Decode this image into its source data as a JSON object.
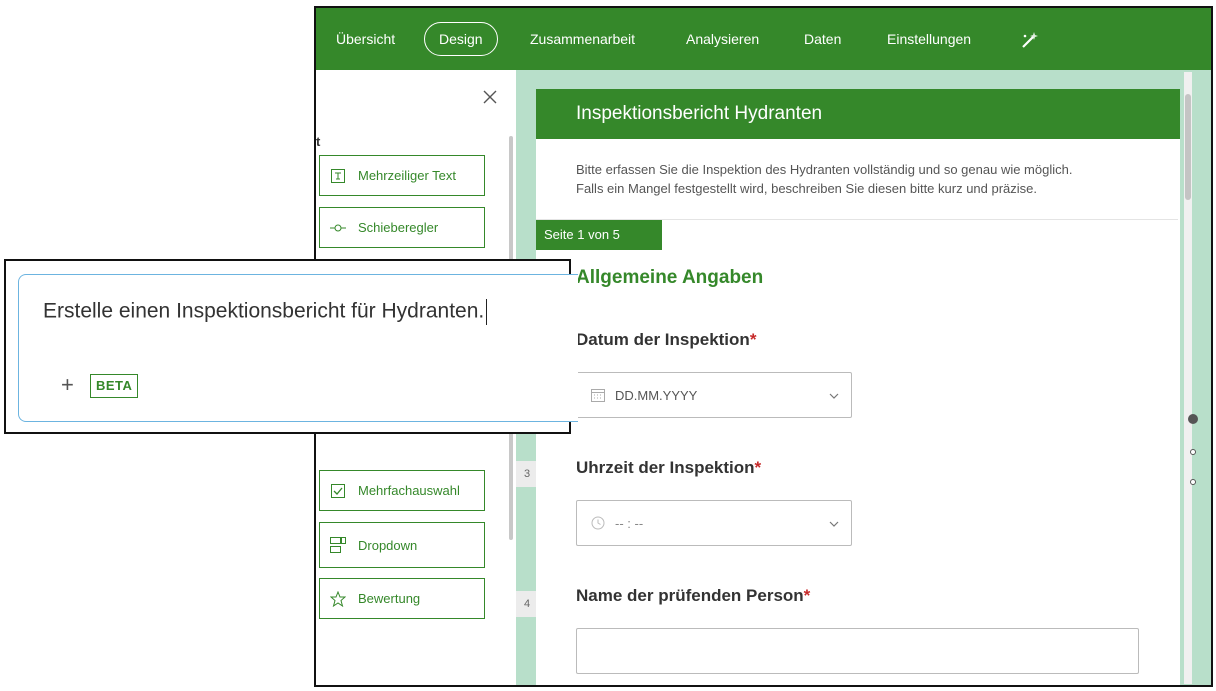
{
  "nav": {
    "overview": "Übersicht",
    "design": "Design",
    "collaborate": "Zusammenarbeit",
    "analyze": "Analysieren",
    "data": "Daten",
    "settings": "Einstellungen",
    "tools_icon": "wand-icon"
  },
  "left_panel": {
    "header_fragment": "t",
    "elements": [
      {
        "label": "Mehrzeiliger Text",
        "icon": "multiline-text-icon"
      },
      {
        "label": "Schieberegler",
        "icon": "slider-icon"
      },
      {
        "label": "Mehrfachauswahl",
        "icon": "checkbox-icon"
      },
      {
        "label": "Dropdown",
        "icon": "dropdown-icon"
      },
      {
        "label": "Bewertung",
        "icon": "star-icon"
      }
    ]
  },
  "row_numbers": [
    "3",
    "4"
  ],
  "form": {
    "title": "Inspektionsbericht Hydranten",
    "description_line1": "Bitte erfassen Sie die Inspektion des Hydranten vollständig und so genau wie möglich.",
    "description_line2": "Falls ein Mangel festgestellt wird, beschreiben Sie diesen bitte kurz und präzise.",
    "page_indicator": "Seite 1 von 5",
    "section_title": "Allgemeine Angaben",
    "questions": [
      {
        "label": "Datum der Inspektion",
        "required": "*",
        "placeholder": "DD.MM.YYYY",
        "icon": "calendar-icon"
      },
      {
        "label": "Uhrzeit der Inspektion",
        "required": "*",
        "placeholder": "-- : --",
        "icon": "clock-icon"
      },
      {
        "label": "Name der prüfenden Person",
        "required": "*",
        "placeholder": ""
      }
    ]
  },
  "prompt": {
    "text": "Erstelle einen Inspektionsbericht für Hydranten.",
    "add_symbol": "+",
    "badge": "BETA"
  },
  "colors": {
    "brand_green": "#35882a",
    "canvas_green": "#b8dfca",
    "required_red": "#c62828",
    "prompt_border": "#6cb4e0"
  }
}
